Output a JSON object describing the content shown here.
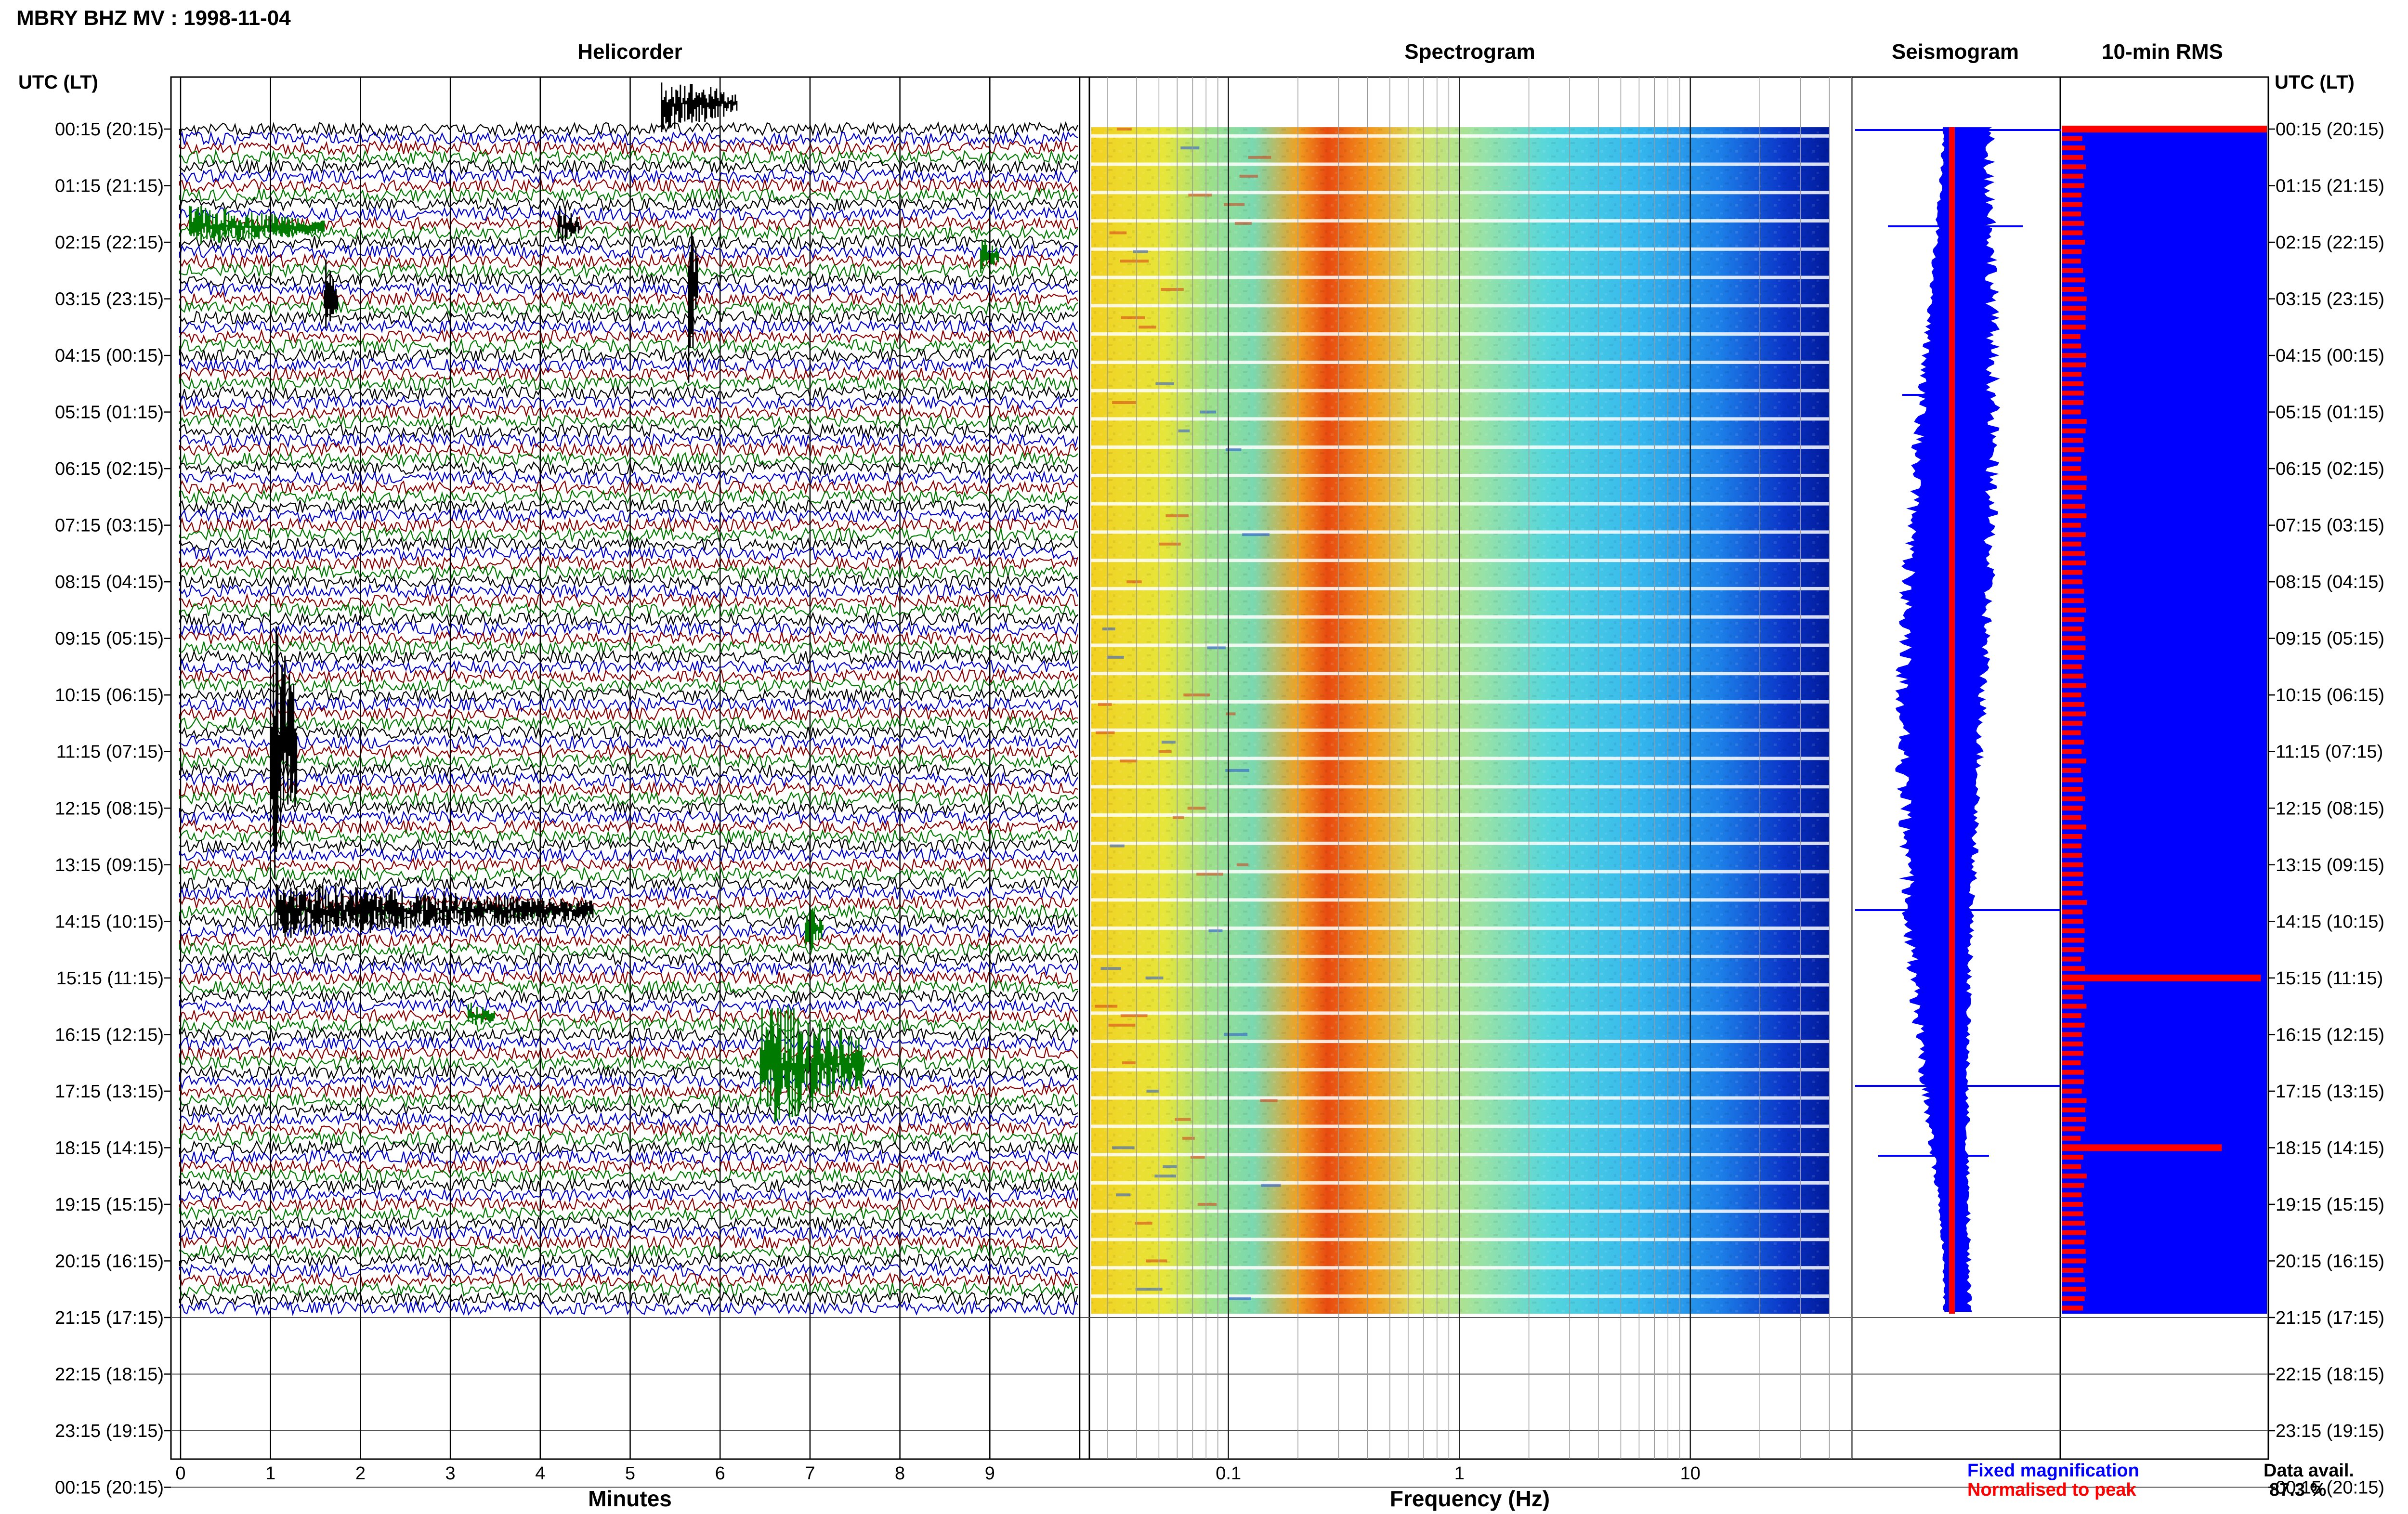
{
  "header": {
    "title": "MBRY BHZ MV : 1998-11-04",
    "time_header_left": "UTC (LT)",
    "time_header_right": "UTC (LT)"
  },
  "panels": {
    "helicorder": "Helicorder",
    "spectrogram": "Spectrogram",
    "seismogram": "Seismogram",
    "rms": "10-min RMS"
  },
  "axes": {
    "minutes_label": "Minutes",
    "minutes_ticks": [
      "0",
      "1",
      "2",
      "3",
      "4",
      "5",
      "6",
      "7",
      "8",
      "9"
    ],
    "frequency_label": "Frequency (Hz)",
    "frequency_ticks": [
      "0.1",
      "1",
      "10"
    ]
  },
  "legend": {
    "fixed": "Fixed magnification",
    "normalised": "Normalised to peak",
    "fixed_color": "#0000ff",
    "normalised_color": "#ff0000"
  },
  "data_availability": {
    "label": "Data avail.",
    "value": "87.3 %"
  },
  "colors": {
    "trace_black": "#000000",
    "trace_blue": "#0000cc",
    "trace_red": "#8b0000",
    "trace_green": "#007a00",
    "seismo_blue": "#0000ff",
    "rms_red": "#ff0000"
  },
  "chart_data": {
    "type": "helicorder",
    "title": "MBRY BHZ MV : 1998-11-04",
    "time_labels": [
      "00:15 (20:15)",
      "01:15 (21:15)",
      "02:15 (22:15)",
      "03:15 (23:15)",
      "04:15 (00:15)",
      "05:15 (01:15)",
      "06:15 (02:15)",
      "07:15 (03:15)",
      "08:15 (04:15)",
      "09:15 (05:15)",
      "10:15 (06:15)",
      "11:15 (07:15)",
      "12:15 (08:15)",
      "13:15 (09:15)",
      "14:15 (10:15)",
      "15:15 (11:15)",
      "16:15 (12:15)",
      "17:15 (13:15)",
      "18:15 (14:15)",
      "19:15 (15:15)",
      "20:15 (16:15)",
      "21:15 (17:15)",
      "22:15 (18:15)",
      "23:15 (19:15)",
      "00:15 (20:15)"
    ],
    "helicorder": {
      "xlabel": "Minutes",
      "xlim": [
        0,
        10
      ],
      "row_minutes": 10,
      "rows_with_data": 126,
      "color_cycle": [
        "black",
        "blue",
        "red",
        "green"
      ]
    },
    "spectrogram": {
      "xlabel": "Frequency (Hz)",
      "xscale": "log",
      "xlim": [
        0.025,
        50
      ],
      "data_fmax": 40,
      "peak_band_hz": [
        0.16,
        0.45
      ]
    },
    "rms": {
      "title": "10-min RMS",
      "typical_relative": 0.25,
      "spikes": [
        {
          "time": "00:15",
          "relative": 1.0
        },
        {
          "time": "15:15",
          "relative": 0.97
        },
        {
          "time": "18:15",
          "relative": 0.78
        }
      ]
    },
    "data_available_percent": 87.3
  }
}
